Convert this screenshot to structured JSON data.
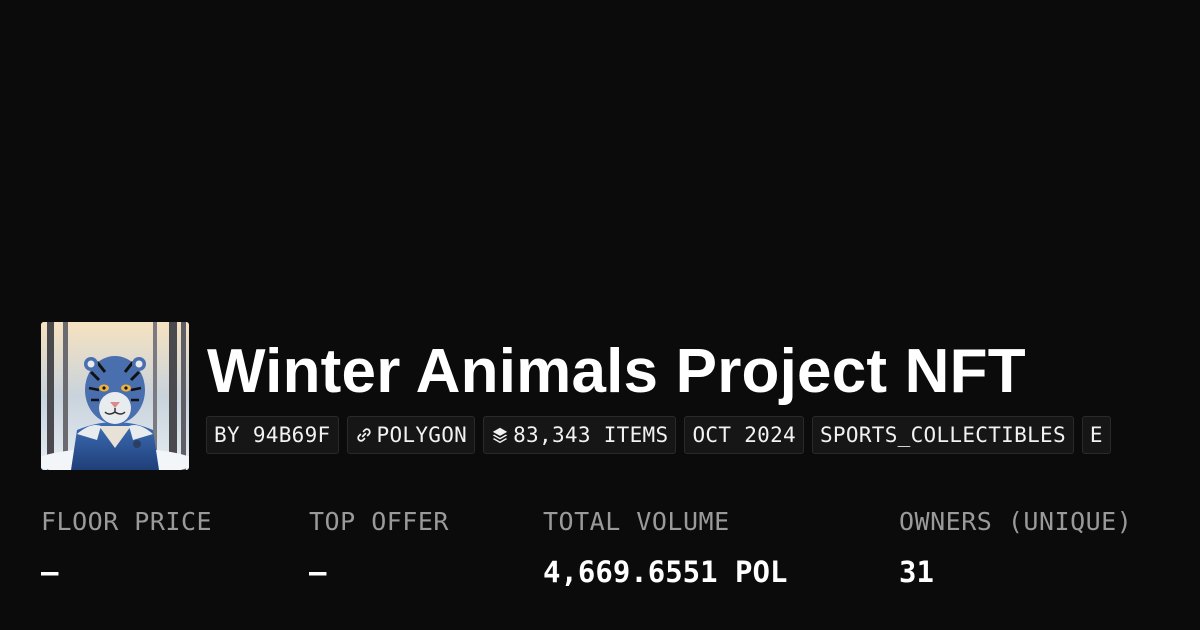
{
  "collection": {
    "title": "Winter Animals Project NFT",
    "avatar_icon": "tiger-in-denim-jacket-image"
  },
  "chips": {
    "creator": "BY 94B69F",
    "chain": "POLYGON",
    "chain_icon": "link-icon",
    "items": "83,343 ITEMS",
    "items_icon": "layers-icon",
    "date": "OCT 2024",
    "category": "SPORTS_COLLECTIBLES",
    "overflow": "E"
  },
  "stats": {
    "floor_label": "FLOOR PRICE",
    "floor_value": "—",
    "offer_label": "TOP OFFER",
    "offer_value": "—",
    "volume_label": "TOTAL VOLUME",
    "volume_value": "4,669.6551 POL",
    "owners_label": "OWNERS (UNIQUE)",
    "owners_value": "31"
  },
  "colors": {
    "background": "#0b0b0b",
    "chip_background": "#161616",
    "label_gray": "#9a9a9a",
    "text": "#ffffff"
  }
}
